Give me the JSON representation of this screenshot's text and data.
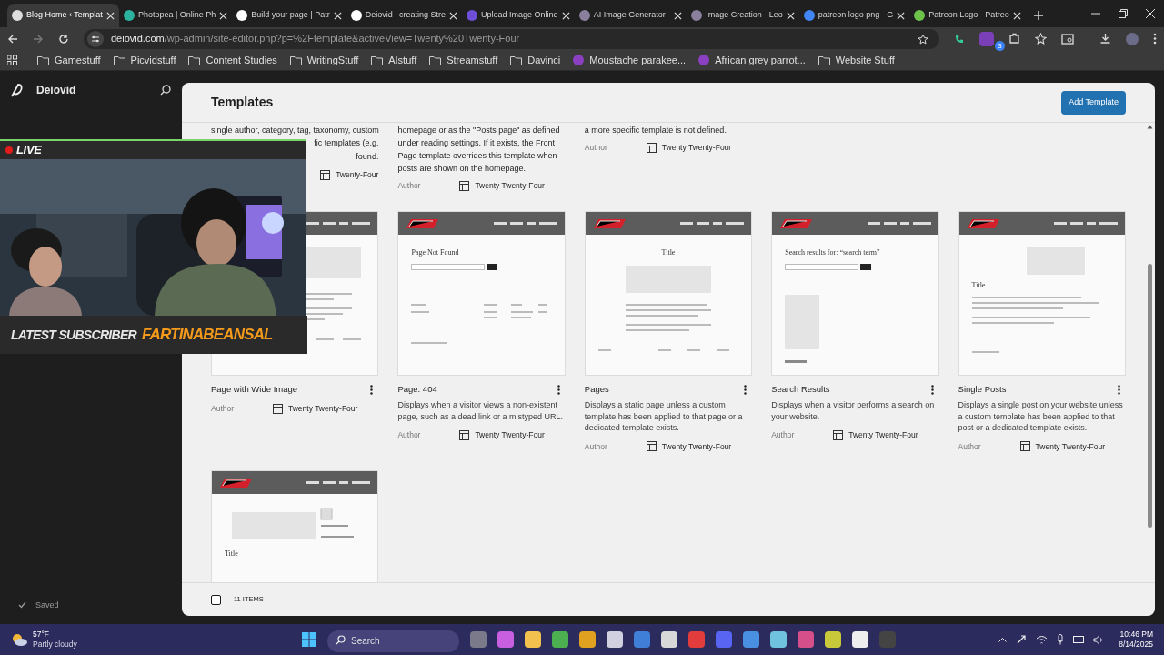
{
  "browser": {
    "tabs": [
      {
        "title": "Blog Home ‹ Templat",
        "selected": true
      },
      {
        "title": "Photopea | Online Ph",
        "selected": false
      },
      {
        "title": "Build your page | Patr",
        "selected": false
      },
      {
        "title": "Deiovid | creating Stre",
        "selected": false
      },
      {
        "title": "Upload Image Online",
        "selected": false
      },
      {
        "title": "AI Image Generator -",
        "selected": false
      },
      {
        "title": "Image Creation - Leo",
        "selected": false
      },
      {
        "title": "patreon logo png - G",
        "selected": false
      },
      {
        "title": "Patreon Logo - Patreo",
        "selected": false
      }
    ],
    "url_host": "deiovid.com",
    "url_path": "/wp-admin/site-editor.php?p=%2Ftemplate&activeView=Twenty%20Twenty-Four",
    "extension_badge": "3",
    "bookmarks": [
      {
        "label": "Gamestuff",
        "kind": "folder"
      },
      {
        "label": "Picvidstuff",
        "kind": "folder"
      },
      {
        "label": "Content Studies",
        "kind": "folder"
      },
      {
        "label": "WritingStuff",
        "kind": "folder"
      },
      {
        "label": "AIstuff",
        "kind": "folder"
      },
      {
        "label": "Streamstuff",
        "kind": "folder"
      },
      {
        "label": "Davinci",
        "kind": "folder"
      },
      {
        "label": "Moustache parakee...",
        "kind": "site"
      },
      {
        "label": "African grey parrot...",
        "kind": "site"
      },
      {
        "label": "Website Stuff",
        "kind": "folder"
      }
    ]
  },
  "sidebar": {
    "site_name": "Deiovid",
    "save_status": "Saved"
  },
  "templates": {
    "title": "Templates",
    "add_button": "Add Template",
    "footer_count": "11 ITEMS",
    "select_all_checked": false,
    "top_row": [
      {
        "description_lines": [
          "single author, category, tag, taxonomy, custom"
        ],
        "fragments": [
          "fic templates (e.g.",
          "found."
        ],
        "theme": "Twenty-Four"
      },
      {
        "description_lines": [
          "homepage or as the \"Posts page\" as defined",
          "under reading settings. If it exists, the Front",
          "Page template overrides this template when",
          "posts are shown on the homepage."
        ],
        "author": "Author",
        "theme": "Twenty Twenty-Four"
      },
      {
        "description_lines": [
          "a more specific template is not defined."
        ],
        "author": "Author",
        "theme": "Twenty Twenty-Four"
      }
    ],
    "cards": [
      {
        "name": "Page with Wide Image",
        "author": "Author",
        "theme": "Twenty Twenty-Four",
        "kind": "wide"
      },
      {
        "name": "Page: 404",
        "description": "Displays when a visitor views a non-existent page, such as a dead link or a mistyped URL.",
        "author": "Author",
        "theme": "Twenty Twenty-Four",
        "kind": "notfound",
        "preview_heading": "Page Not Found"
      },
      {
        "name": "Pages",
        "description": "Displays a static page unless a custom template has been applied to that page or a dedicated template exists.",
        "author": "Author",
        "theme": "Twenty Twenty-Four",
        "kind": "page",
        "preview_heading": "Title"
      },
      {
        "name": "Search Results",
        "description": "Displays when a visitor performs a search on your website.",
        "author": "Author",
        "theme": "Twenty Twenty-Four",
        "kind": "search",
        "preview_heading": "Search results for: “search term”"
      },
      {
        "name": "Single Posts",
        "description": "Displays a single post on your website unless a custom template has been applied to that post or a dedicated template exists.",
        "author": "Author",
        "theme": "Twenty Twenty-Four",
        "kind": "single",
        "preview_heading": "Title"
      },
      {
        "kind": "post",
        "preview_heading": "Title"
      }
    ]
  },
  "stream_overlay": {
    "live_label": "LIVE",
    "subscriber_label": "LATEST SUBSCRIBER",
    "subscriber_name": "FARTINABEANSAL"
  },
  "taskbar": {
    "temperature": "57°F",
    "weather": "Partly cloudy",
    "search_placeholder": "Search",
    "time": "10:46 PM",
    "date": "8/14/2025"
  }
}
